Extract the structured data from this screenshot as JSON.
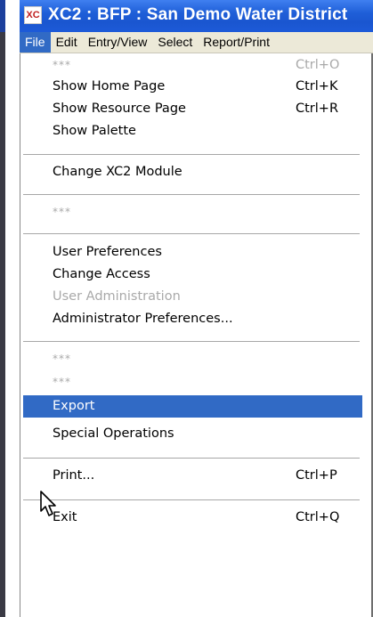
{
  "window": {
    "title": "XC2 : BFP : San Demo Water District",
    "icon_text": "XC",
    "icon": "xc2-app-icon"
  },
  "menubar": {
    "items": [
      "File",
      "Edit",
      "Entry/View",
      "Select",
      "Report/Print"
    ],
    "active": "File"
  },
  "file_menu": {
    "items": [
      {
        "label": "***",
        "shortcut": "Ctrl+O",
        "state": "disabled"
      },
      {
        "label": "Show Home Page",
        "shortcut": "Ctrl+K"
      },
      {
        "label": "Show Resource Page",
        "shortcut": "Ctrl+R"
      },
      {
        "label": "Show Palette",
        "shortcut": ""
      },
      {
        "label": "Change XC2 Module",
        "shortcut": ""
      },
      {
        "label": "***",
        "shortcut": "",
        "state": "disabled"
      },
      {
        "label": "User Preferences",
        "shortcut": ""
      },
      {
        "label": "Change Access",
        "shortcut": ""
      },
      {
        "label": "User Administration",
        "shortcut": "",
        "state": "disabled"
      },
      {
        "label": "Administrator Preferences...",
        "shortcut": ""
      },
      {
        "label": "***",
        "shortcut": "",
        "state": "disabled"
      },
      {
        "label": "***",
        "shortcut": "",
        "state": "disabled"
      },
      {
        "label": "Export",
        "shortcut": "",
        "state": "highlighted"
      },
      {
        "label": "Special Operations",
        "shortcut": ""
      },
      {
        "label": "Print...",
        "shortcut": "Ctrl+P"
      },
      {
        "label": "Exit",
        "shortcut": "Ctrl+Q"
      }
    ]
  },
  "colors": {
    "titlebar": "#1f5fd8",
    "highlight": "#316ac5",
    "menubar": "#ece9d8",
    "disabled_text": "#a9a9a9"
  },
  "cursor": "arrow-cursor-icon"
}
